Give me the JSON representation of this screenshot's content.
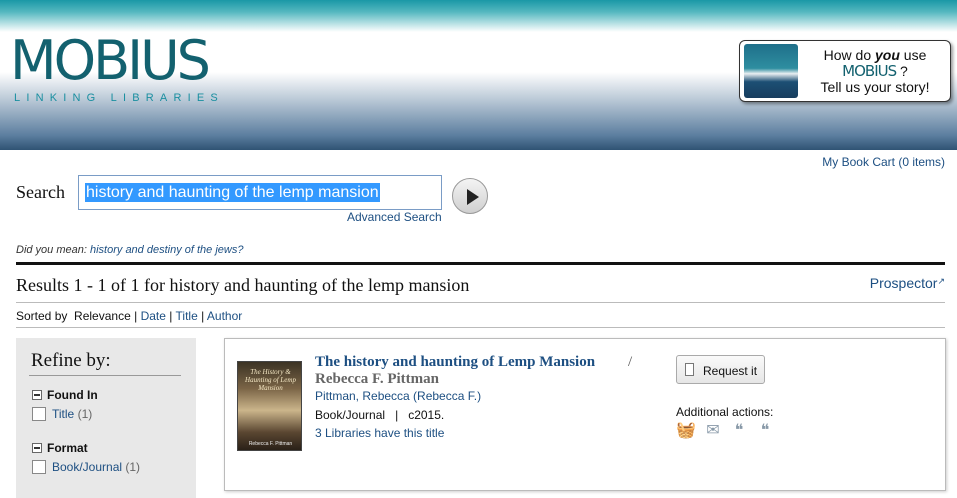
{
  "header": {
    "logo_text": "MOBIUS",
    "logo_sub": "LINKING LIBRARIES",
    "promo": {
      "line1a": "How do ",
      "line1b": "you",
      "line1c": " use",
      "brand": "MOBIUS",
      "q": " ?",
      "line3": "Tell us your story!"
    }
  },
  "cart": "My Book Cart (0 items)",
  "search": {
    "label": "Search",
    "value": "history and haunting of the lemp mansion",
    "advanced": "Advanced Search"
  },
  "did_you_mean": {
    "prefix": "Did you mean: ",
    "suggestion": "history and destiny of the jews?"
  },
  "results": {
    "summary": "Results 1 - 1 of 1 for history and haunting of the lemp mansion",
    "prospector": "Prospector"
  },
  "sort": {
    "prefix": "Sorted by",
    "current": "Relevance",
    "sep": "|",
    "options": [
      "Date",
      "Title",
      "Author"
    ]
  },
  "refine": {
    "title": "Refine by:",
    "facets": [
      {
        "name": "Found In",
        "items": [
          {
            "label": "Title",
            "count": "(1)"
          }
        ]
      },
      {
        "name": "Format",
        "items": [
          {
            "label": "Book/Journal",
            "count": "(1)"
          }
        ]
      }
    ]
  },
  "record": {
    "cover_title": "The History & Haunting of Lemp Mansion",
    "cover_author": "Rebecca F. Pittman",
    "title": "The history and haunting of Lemp Mansion",
    "slash": "/",
    "author_bold": "Rebecca F. Pittman",
    "author_link": "Pittman, Rebecca (Rebecca F.)",
    "format": "Book/Journal",
    "sep": "|",
    "date": "c2015.",
    "libraries": "3 Libraries have this title",
    "request": "Request it",
    "additional": "Additional actions:",
    "actions": [
      "basket-icon",
      "email-icon",
      "cite-icon",
      "cite-icon"
    ]
  },
  "colors": {
    "link": "#1d4f82",
    "brand": "#13616f",
    "highlight": "#3399ff"
  }
}
